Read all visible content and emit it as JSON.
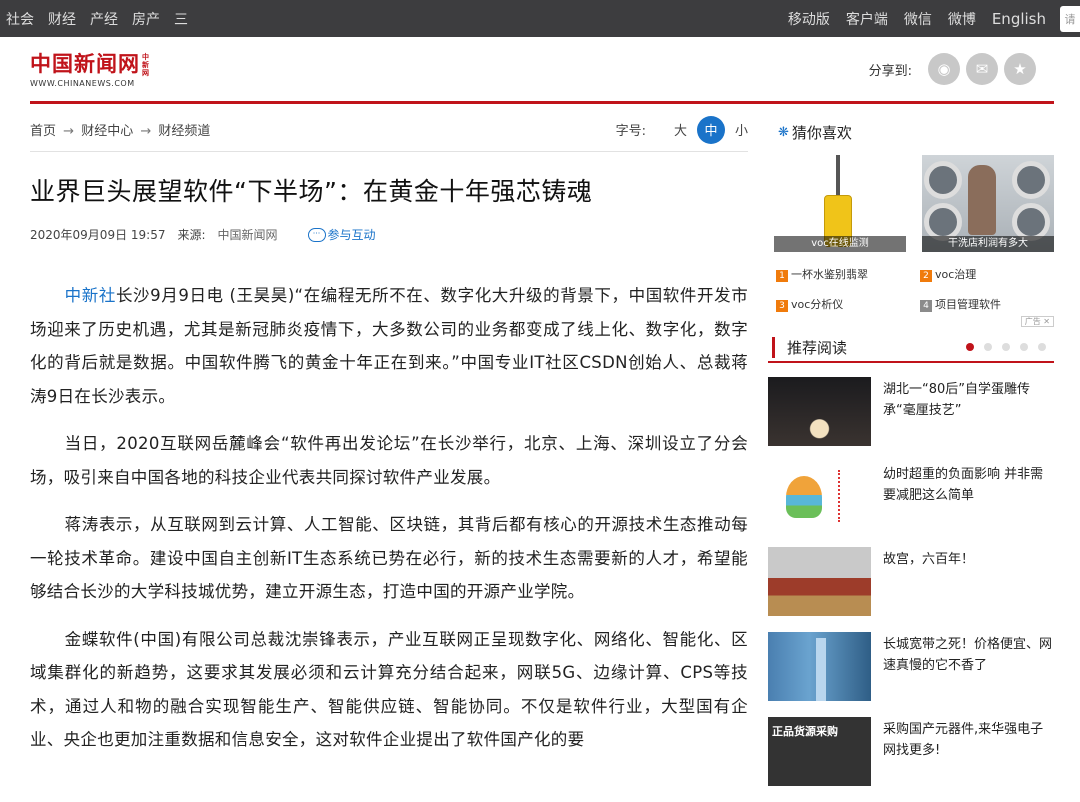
{
  "topbar": {
    "left_items": [
      "社会",
      "财经",
      "产经",
      "房产",
      "三"
    ],
    "right_items": [
      "移动版",
      "客户端",
      "微信",
      "微博"
    ],
    "english": "English",
    "search_stub": "请"
  },
  "logo": {
    "name": "中国新闻网",
    "small": "中新网",
    "url_text": "WWW.CHINANEWS.COM"
  },
  "share": {
    "label": "分享到:",
    "icons": [
      "weibo-icon",
      "wechat-icon",
      "star-icon"
    ]
  },
  "breadcrumb": {
    "items": [
      "首页",
      "财经中心",
      "财经频道"
    ],
    "sep": "→"
  },
  "font_size": {
    "label": "字号:",
    "options": [
      "大",
      "中",
      "小"
    ],
    "selected": "中"
  },
  "article": {
    "title": "业界巨头展望软件“下半场”：在黄金十年强芯铸魂",
    "datetime": "2020年09月09日 19:57",
    "source_label": "来源:",
    "source": "中国新闻网",
    "interact": "参与互动",
    "p1_highlight": "中新社",
    "p1_rest": "长沙9月9日电 (王昊昊)“在编程无所不在、数字化大升级的背景下，中国软件开发市场迎来了历史机遇，尤其是新冠肺炎疫情下，大多数公司的业务都变成了线上化、数字化，数字化的背后就是数据。中国软件腾飞的黄金十年正在到来。”中国专业IT社区CSDN创始人、总裁蒋涛9日在长沙表示。",
    "p2": "当日，2020互联网岳麓峰会“软件再出发论坛”在长沙举行，北京、上海、深圳设立了分会场，吸引来自中国各地的科技企业代表共同探讨软件产业发展。",
    "p3": "蒋涛表示，从互联网到云计算、人工智能、区块链，其背后都有核心的开源技术生态推动每一轮技术革命。建设中国自主创新IT生态系统已势在必行，新的技术生态需要新的人才，希望能够结合长沙的大学科技城优势，建立开源生态，打造中国的开源产业学院。",
    "p4": "金蝶软件(中国)有限公司总裁沈崇锋表示，产业互联网正呈现数字化、网络化、智能化、区域集群化的新趋势，这要求其发展必须和云计算充分结合起来，网联5G、边缘计算、CPS等技术，通过人和物的融合实现智能生产、智能供应链、智能协同。不仅是软件行业，大型国有企业、央企也更加注重数据和信息安全，这对软件企业提出了软件国产化的要"
  },
  "sidebar": {
    "guess_title": "猜你喜欢",
    "guess_images": [
      {
        "caption": "voc在线监测"
      },
      {
        "caption": "干洗店利润有多大"
      }
    ],
    "ads": [
      {
        "num": "1",
        "text": "一杯水鉴别翡翠"
      },
      {
        "num": "2",
        "text": "voc治理"
      },
      {
        "num": "3",
        "text": "voc分析仪"
      },
      {
        "num": "4",
        "text": "项目管理软件"
      }
    ],
    "ad_tag": "广告 ✕",
    "rec_title": "推荐阅读",
    "rec_items": [
      {
        "text": "湖北一“80后”自学蛋雕传承“毫厘技艺”"
      },
      {
        "text": "幼时超重的负面影响 并非需要减肥这么简单"
      },
      {
        "text": "故宫，六百年！"
      },
      {
        "text": "长城宽带之死！价格便宜、网速真慢的它不香了"
      },
      {
        "text": "采购国产元器件,来华强电子网找更多!",
        "thumb_text": "正品货源采购"
      }
    ]
  }
}
